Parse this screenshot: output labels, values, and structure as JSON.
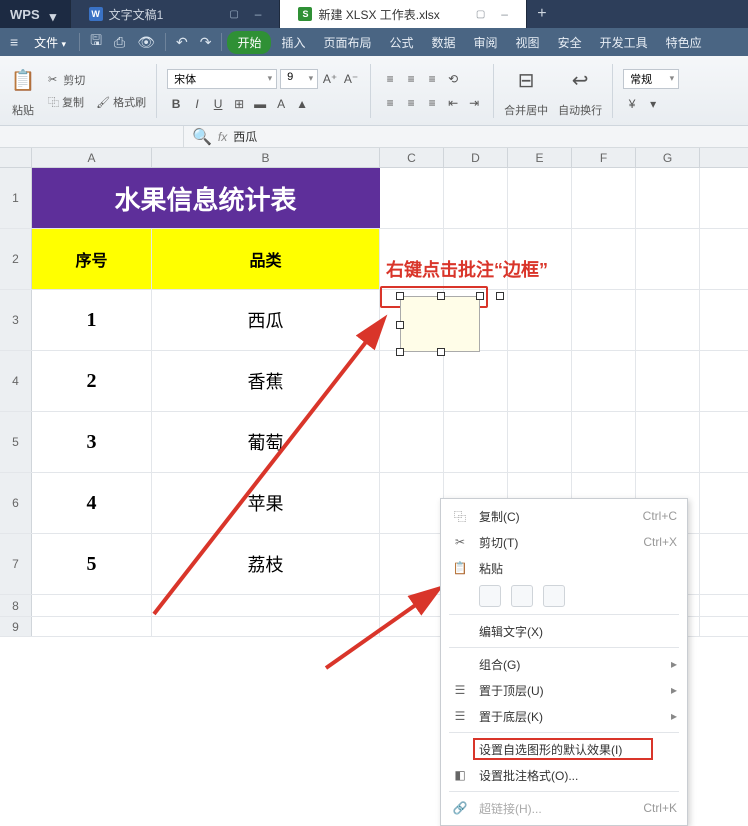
{
  "titlebar": {
    "wps_label": "WPS",
    "tabs": [
      {
        "icon": "W",
        "icon_bg": "#3a72c5",
        "label": "文字文稿1"
      },
      {
        "icon": "S",
        "icon_bg": "#2f9035",
        "label": "新建 XLSX 工作表.xlsx",
        "active": true
      }
    ],
    "new_tab": "+"
  },
  "menubar": {
    "file": "文件",
    "tabs": [
      "开始",
      "插入",
      "页面布局",
      "公式",
      "数据",
      "审阅",
      "视图",
      "安全",
      "开发工具",
      "特色应"
    ]
  },
  "toolbar": {
    "paste_label": "粘贴",
    "cut_label": "剪切",
    "copy_label": "复制",
    "formatpainter_label": "格式刷",
    "font_name": "宋体",
    "font_size": "9",
    "merge_label": "合并居中",
    "wrap_label": "自动换行",
    "style_label": "常规"
  },
  "formula": {
    "fx": "fx",
    "value": "西瓜"
  },
  "columns": [
    "A",
    "B",
    "C",
    "D",
    "E",
    "F",
    "G"
  ],
  "rownums": [
    "1",
    "2",
    "3",
    "4",
    "5",
    "6",
    "7",
    "8",
    "9"
  ],
  "table": {
    "title": "水果信息统计表",
    "headers": {
      "a": "序号",
      "b": "品类"
    },
    "rows": [
      {
        "num": "1",
        "item": "西瓜"
      },
      {
        "num": "2",
        "item": "香蕉"
      },
      {
        "num": "3",
        "item": "葡萄"
      },
      {
        "num": "4",
        "item": "苹果"
      },
      {
        "num": "5",
        "item": "荔枝"
      }
    ]
  },
  "annotation": "右键点击批注“边框”",
  "ctx": {
    "copy": "复制(C)",
    "copy_sc": "Ctrl+C",
    "cut": "剪切(T)",
    "cut_sc": "Ctrl+X",
    "paste": "粘贴",
    "edit_text": "编辑文字(X)",
    "group": "组合(G)",
    "to_front": "置于顶层(U)",
    "to_back": "置于底层(K)",
    "default_fx": "设置自选图形的默认效果(I)",
    "format_comment": "设置批注格式(O)...",
    "hyperlink": "超链接(H)...",
    "hyperlink_sc": "Ctrl+K"
  }
}
